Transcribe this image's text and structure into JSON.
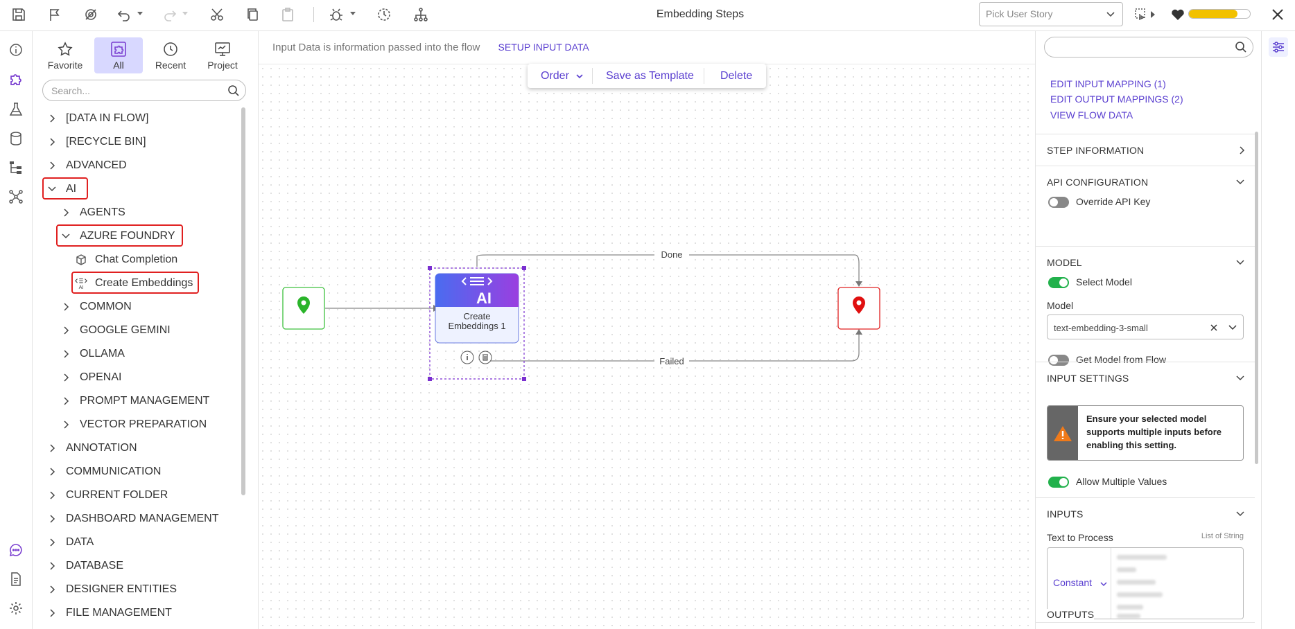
{
  "app": {
    "title": "Embedding Steps",
    "accent_color": "#5a3fd0",
    "user_story_placeholder": "Pick User Story",
    "progress_fraction": 0.8
  },
  "toolbar_icons": [
    "save-icon",
    "flag-icon",
    "no-tracking-icon",
    "undo-icon",
    "redo-icon",
    "cut-icon",
    "copy-icon",
    "paste-icon",
    "debug-icon",
    "history-icon",
    "hierarchy-icon"
  ],
  "left_rail": [
    "info-icon",
    "puzzle-icon",
    "flask-icon",
    "database-icon",
    "tree-icon",
    "network-icon",
    "chat-icon",
    "document-icon",
    "settings-icon"
  ],
  "panel": {
    "tabs": [
      {
        "label": "Favorite",
        "icon": "star-icon"
      },
      {
        "label": "All",
        "icon": "all-icon"
      },
      {
        "label": "Recent",
        "icon": "clock-icon"
      },
      {
        "label": "Project",
        "icon": "project-icon"
      }
    ],
    "search_placeholder": "Search...",
    "tree": [
      {
        "label": "[DATA IN FLOW]",
        "level": 0,
        "expanded": false
      },
      {
        "label": "[RECYCLE BIN]",
        "level": 0,
        "expanded": false
      },
      {
        "label": "ADVANCED",
        "level": 0,
        "expanded": false
      },
      {
        "label": "AI",
        "level": 0,
        "expanded": true,
        "highlight": true
      },
      {
        "label": "AGENTS",
        "level": 1,
        "expanded": false
      },
      {
        "label": "AZURE FOUNDRY",
        "level": 1,
        "expanded": true,
        "highlight": true
      },
      {
        "label": "Chat Completion",
        "level": 2,
        "leaf": true,
        "icon": "cube-icon"
      },
      {
        "label": "Create Embeddings",
        "level": 2,
        "leaf": true,
        "icon": "ai-embed-icon",
        "highlight": true
      },
      {
        "label": "COMMON",
        "level": 1,
        "expanded": false
      },
      {
        "label": "GOOGLE GEMINI",
        "level": 1,
        "expanded": false
      },
      {
        "label": "OLLAMA",
        "level": 1,
        "expanded": false
      },
      {
        "label": "OPENAI",
        "level": 1,
        "expanded": false
      },
      {
        "label": "PROMPT MANAGEMENT",
        "level": 1,
        "expanded": false
      },
      {
        "label": "VECTOR PREPARATION",
        "level": 1,
        "expanded": false
      },
      {
        "label": "ANNOTATION",
        "level": 0,
        "expanded": false
      },
      {
        "label": "COMMUNICATION",
        "level": 0,
        "expanded": false
      },
      {
        "label": "CURRENT FOLDER",
        "level": 0,
        "expanded": false
      },
      {
        "label": "DASHBOARD MANAGEMENT",
        "level": 0,
        "expanded": false
      },
      {
        "label": "DATA",
        "level": 0,
        "expanded": false
      },
      {
        "label": "DATABASE",
        "level": 0,
        "expanded": false
      },
      {
        "label": "DESIGNER ENTITIES",
        "level": 0,
        "expanded": false
      },
      {
        "label": "FILE MANAGEMENT",
        "level": 0,
        "expanded": false
      }
    ]
  },
  "canvas": {
    "input_info": "Input Data is information passed into the flow",
    "setup_link": "SETUP INPUT DATA",
    "toolbar": {
      "order": "Order",
      "save_template": "Save as Template",
      "delete": "Delete"
    },
    "step": {
      "badge": "AI",
      "name_line1": "Create",
      "name_line2": "Embeddings 1"
    },
    "edges": {
      "done": "Done",
      "failed": "Failed"
    }
  },
  "right": {
    "links": [
      "EDIT INPUT MAPPING (1)",
      "EDIT OUTPUT MAPPINGS (2)",
      "VIEW FLOW DATA"
    ],
    "sections": {
      "step_info": "STEP INFORMATION",
      "api": "API CONFIGURATION",
      "model": "MODEL",
      "input_settings": "INPUT SETTINGS",
      "inputs": "INPUTS",
      "outputs": "OUTPUTS"
    },
    "override_api_key": {
      "label": "Override API Key",
      "on": false
    },
    "select_model": {
      "label": "Select Model",
      "on": true
    },
    "model_label": "Model",
    "model_value": "text-embedding-3-small",
    "get_model_from_flow": {
      "label": "Get Model from Flow",
      "on": false
    },
    "warning": "Ensure your selected model supports multiple inputs before enabling this setting.",
    "allow_multiple": {
      "label": "Allow Multiple Values",
      "on": true
    },
    "text_to_process": "Text to Process",
    "list_type": "List of String",
    "constant": "Constant"
  }
}
